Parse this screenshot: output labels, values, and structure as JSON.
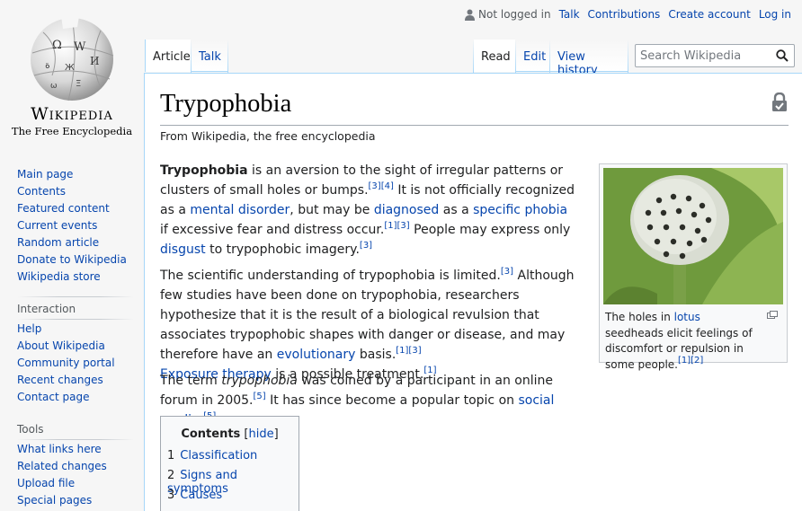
{
  "logo": {
    "wordmark": "Wikipedia",
    "tagline": "The Free Encyclopedia"
  },
  "personal": {
    "status": "Not logged in",
    "links": [
      "Talk",
      "Contributions",
      "Create account",
      "Log in"
    ]
  },
  "tabs": {
    "left": [
      "Article",
      "Talk"
    ],
    "right": [
      "Read",
      "Edit",
      "View history"
    ]
  },
  "search": {
    "placeholder": "Search Wikipedia"
  },
  "sidebar": {
    "main": [
      "Main page",
      "Contents",
      "Featured content",
      "Current events",
      "Random article",
      "Donate to Wikipedia",
      "Wikipedia store"
    ],
    "interaction_head": "Interaction",
    "interaction": [
      "Help",
      "About Wikipedia",
      "Community portal",
      "Recent changes",
      "Contact page"
    ],
    "tools_head": "Tools",
    "tools": [
      "What links here",
      "Related changes",
      "Upload file",
      "Special pages"
    ]
  },
  "article": {
    "title": "Trypophobia",
    "from": "From Wikipedia, the free encyclopedia",
    "p1": {
      "bold": "Trypophobia",
      "t1": " is an aversion to the sight of irregular patterns or clusters of small holes or bumps.",
      "s1": "[3][4]",
      "t2": " It is not officially recognized as a ",
      "l1": "mental disorder",
      "t3": ", but may be ",
      "l2": "diagnosed",
      "t4": " as a ",
      "l3": "specific phobia",
      "t5": " if excessive fear and distress occur.",
      "s2": "[1][3]",
      "t6": " People may express only ",
      "l4": "disgust",
      "t7": " to trypophobic imagery.",
      "s3": "[3]"
    },
    "p2": {
      "t1": "The scientific understanding of trypophobia is limited.",
      "s1": "[3]",
      "t2": " Although few studies have been done on trypophobia, researchers hypothesize that it is the result of a biological revulsion that associates trypophobic shapes with danger or disease, and may therefore have an ",
      "l1": "evolutionary",
      "t3": " basis.",
      "s2": "[1][3]",
      "l2": "Exposure therapy",
      "t4": " is a possible treatment.",
      "s3": "[1]"
    },
    "p3": {
      "t1": "The term ",
      "i1": "trypophobia",
      "t2": " was coined by a participant in an online forum in 2005.",
      "s1": "[5]",
      "t3": " It has since become a popular topic on ",
      "l1": "social media",
      "t4": ".",
      "s2": "[5]"
    }
  },
  "thumb": {
    "cap1": "The holes in ",
    "link": "lotus",
    "cap2": " seedheads elicit feelings of discomfort or repulsion in some people.",
    "sup": "[1][2]"
  },
  "toc": {
    "title": "Contents",
    "hide_open": " [",
    "hide": "hide",
    "hide_close": "]",
    "items": [
      {
        "num": "1",
        "label": "Classification"
      },
      {
        "num": "2",
        "label": "Signs and symptoms"
      },
      {
        "num": "3",
        "label": "Causes"
      }
    ]
  }
}
